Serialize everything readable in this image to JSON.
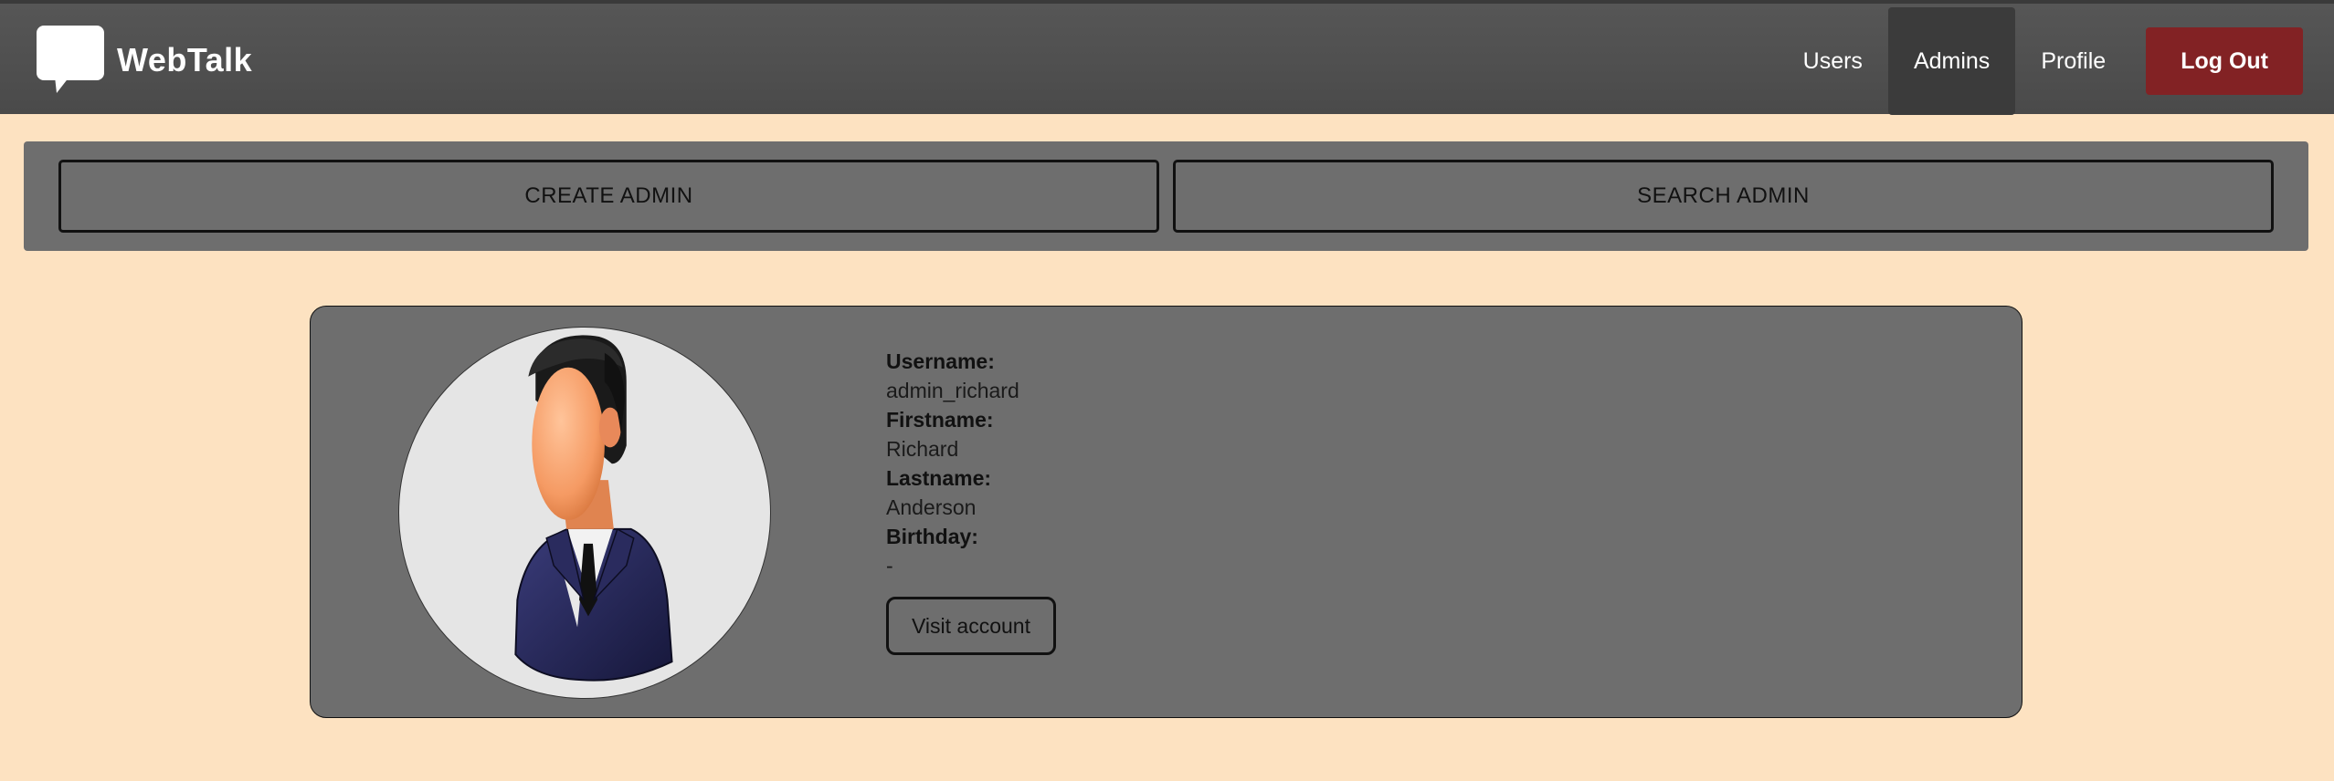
{
  "brand": {
    "name": "WebTalk",
    "icon": "speech-bubble-icon"
  },
  "nav": {
    "links": [
      {
        "label": "Users",
        "active": false
      },
      {
        "label": "Admins",
        "active": true
      },
      {
        "label": "Profile",
        "active": false
      }
    ],
    "logout_label": "Log Out"
  },
  "actions": {
    "create_label": "CREATE ADMIN",
    "search_label": "SEARCH ADMIN"
  },
  "admin_card": {
    "avatar_icon": "faceless-businessman-avatar",
    "fields": {
      "username_label": "Username:",
      "username_value": "admin_richard",
      "firstname_label": "Firstname:",
      "firstname_value": "Richard",
      "lastname_label": "Lastname:",
      "lastname_value": "Anderson",
      "birthday_label": "Birthday:",
      "birthday_value": "-"
    },
    "visit_label": "Visit account"
  },
  "colors": {
    "page_bg": "#fde2c1",
    "navbar_bg": "#4f4f4f",
    "panel_bg": "#6e6e6e",
    "logout_bg": "#822224"
  }
}
